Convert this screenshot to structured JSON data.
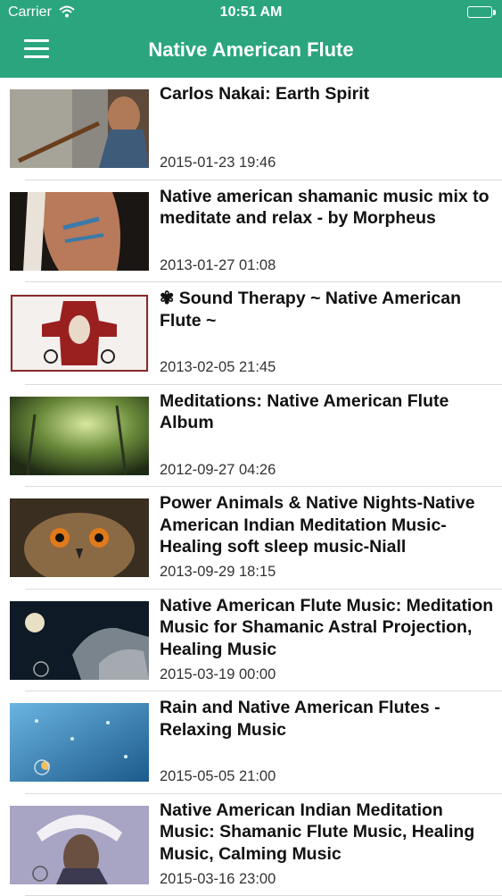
{
  "status_bar": {
    "carrier": "Carrier",
    "time": "10:51 AM"
  },
  "header": {
    "title": "Native American Flute"
  },
  "colors": {
    "header_bg": "#2ba57e"
  },
  "videos": [
    {
      "title": "Carlos Nakai: Earth Spirit",
      "date": "2015-01-23 19:46"
    },
    {
      "title": "Native american shamanic music mix to meditate and relax - by Morpheus",
      "date": "2013-01-27 01:08"
    },
    {
      "title": "✾ Sound Therapy ~ Native American Flute ~",
      "date": "2013-02-05 21:45"
    },
    {
      "title": "Meditations: Native American Flute Album",
      "date": "2012-09-27 04:26"
    },
    {
      "title": "Power Animals & Native Nights-Native American Indian Meditation Music-Healing soft sleep music-Niall",
      "date": "2013-09-29 18:15"
    },
    {
      "title": "Native American Flute Music: Meditation Music for Shamanic Astral Projection, Healing Music",
      "date": "2015-03-19 00:00"
    },
    {
      "title": "Rain and Native American Flutes - Relaxing Music",
      "date": "2015-05-05 21:00"
    },
    {
      "title": "Native American Indian Meditation Music: Shamanic Flute Music, Healing Music, Calming Music",
      "date": "2015-03-16 23:00"
    }
  ]
}
